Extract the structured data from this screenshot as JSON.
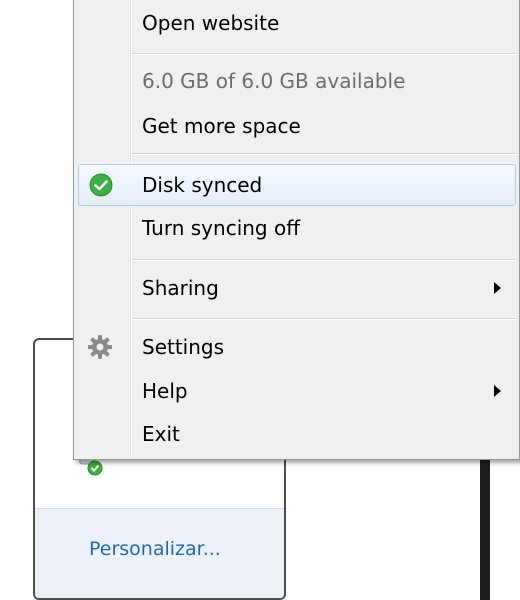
{
  "menu": {
    "open_website": "Open website",
    "storage_status": "6.0 GB of 6.0 GB available",
    "get_more_space": "Get more space",
    "disk_synced": "Disk synced",
    "turn_syncing_off": "Turn syncing off",
    "sharing": "Sharing",
    "settings": "Settings",
    "help": "Help",
    "exit": "Exit"
  },
  "tray_popup": {
    "personalize_link": "Personalizar..."
  },
  "icons": {
    "synced": "check-circle-icon",
    "settings": "gear-icon",
    "submenu": "chevron-right-icon",
    "tray": "cloud-sync-icon"
  },
  "colors": {
    "synced_green": "#3cb043",
    "highlight_border": "#aecdf0",
    "link_blue": "#1f6bb5"
  }
}
